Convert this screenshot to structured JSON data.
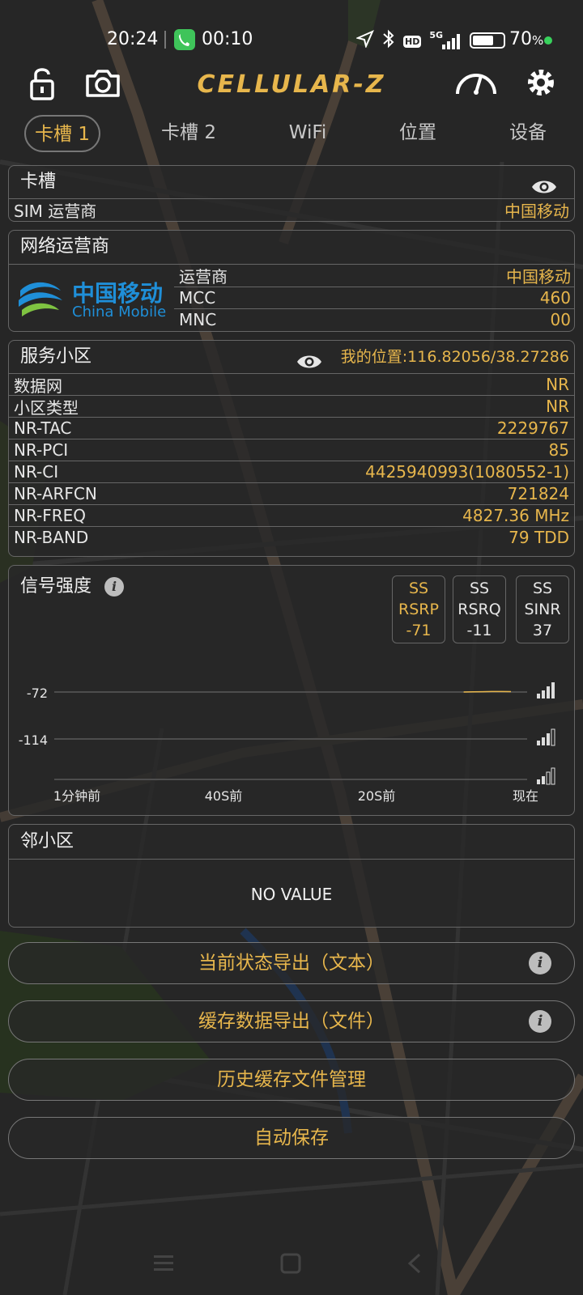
{
  "status_bar": {
    "time": "20:24",
    "call_timer": "00:10",
    "icons": [
      "location-arrow-icon",
      "bluetooth-icon",
      "hd-icon",
      "5g-signal-icon"
    ],
    "network_label": "5G",
    "hd_label": "HD",
    "battery_percent": "70",
    "battery_unit": "%",
    "battery_level": 0.7
  },
  "app": {
    "logo": "CELLULAR-Z"
  },
  "tabs": [
    {
      "label": "卡槽 1",
      "active": true
    },
    {
      "label": "卡槽 2",
      "active": false
    },
    {
      "label": "WiFi",
      "active": false
    },
    {
      "label": "位置",
      "active": false
    },
    {
      "label": "设备",
      "active": false
    }
  ],
  "slot_panel": {
    "title": "卡槽",
    "rows": [
      {
        "key": "SIM 运营商",
        "value": "中国移动"
      }
    ]
  },
  "operator_panel": {
    "title": "网络运营商",
    "logo_cn": "中国移动",
    "logo_en": "China Mobile",
    "rows": [
      {
        "key": "运营商",
        "value": "中国移动"
      },
      {
        "key": "MCC",
        "value": "460"
      },
      {
        "key": "MNC",
        "value": "00"
      }
    ]
  },
  "cell_panel": {
    "title": "服务小区",
    "location": "我的位置:116.82056/38.27286",
    "rows": [
      {
        "key": "数据网",
        "value": "NR"
      },
      {
        "key": "小区类型",
        "value": "NR"
      },
      {
        "key": "NR-TAC",
        "value": "2229767"
      },
      {
        "key": "NR-PCI",
        "value": "85"
      },
      {
        "key": "NR-CI",
        "value": "4425940993(1080552-1)"
      },
      {
        "key": "NR-ARFCN",
        "value": "721824"
      },
      {
        "key": "NR-FREQ",
        "value": "4827.36 MHz"
      },
      {
        "key": "NR-BAND",
        "value": "79 TDD"
      }
    ]
  },
  "signal_panel": {
    "title": "信号强度",
    "metrics": [
      {
        "line1": "SS",
        "line2": "RSRP",
        "value": "-71",
        "highlight": true
      },
      {
        "line1": "SS",
        "line2": "RSRQ",
        "value": "-11",
        "highlight": false
      },
      {
        "line1": "SS",
        "line2": "SINR",
        "value": "37",
        "highlight": false
      }
    ],
    "y_labels": [
      "-72",
      "-114"
    ],
    "x_labels": [
      "1分钟前",
      "40S前",
      "20S前",
      "现在"
    ]
  },
  "chart_data": {
    "type": "line",
    "title": "",
    "x": [
      -12,
      -8,
      -4,
      0
    ],
    "series": [
      {
        "values": [
          -72,
          -72,
          -72,
          -72
        ]
      }
    ],
    "y_ticks": [
      -72,
      -114
    ],
    "x_tick_labels": [
      "1分钟前",
      "40S前",
      "20S前",
      "现在"
    ],
    "grid": true
  },
  "neighbor_panel": {
    "title": "邻小区",
    "empty_text": "NO VALUE"
  },
  "buttons": [
    {
      "label": "当前状态导出（文本）",
      "info": true
    },
    {
      "label": "缓存数据导出（文件）",
      "info": true
    },
    {
      "label": "历史缓存文件管理",
      "info": false
    },
    {
      "label": "自动保存",
      "info": false
    }
  ],
  "colors": {
    "accent": "#e7b64c",
    "background": "#262626",
    "call_green": "#3fc45a",
    "battery_dot": "#38d15c"
  }
}
